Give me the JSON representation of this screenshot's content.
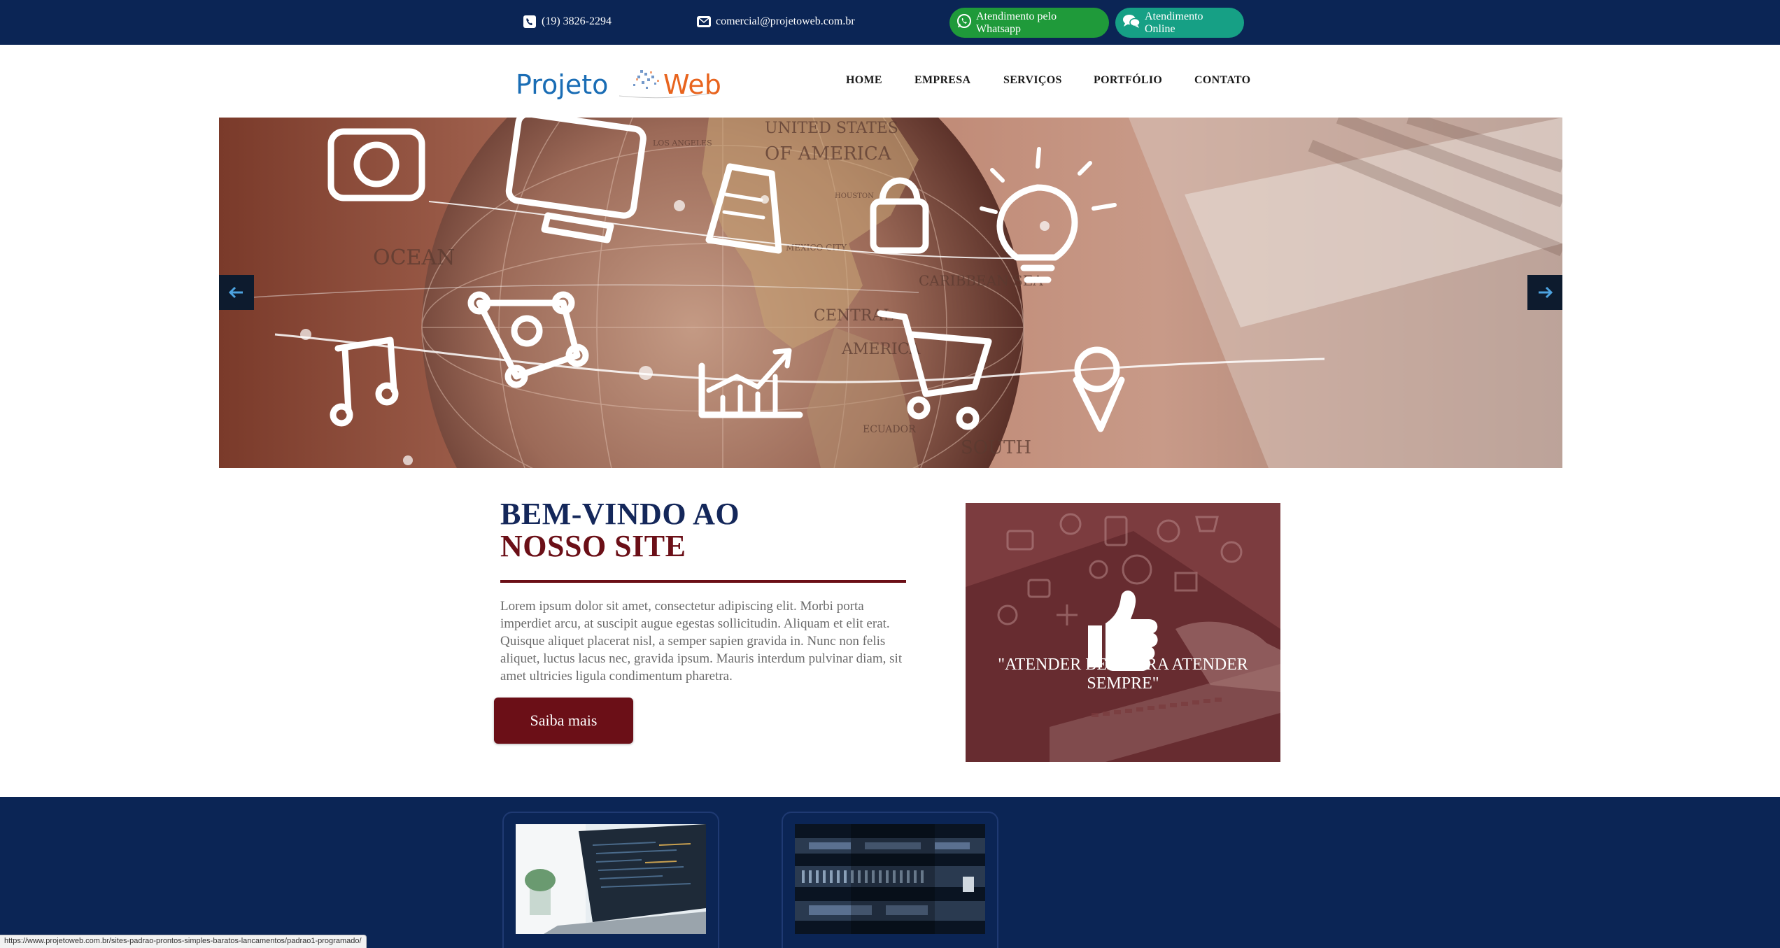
{
  "topbar": {
    "phone": "(19) 3826-2294",
    "email": "comercial@projetoweb.com.br",
    "whatsapp_label": "Atendimento pelo Whatsapp",
    "online_label": "Atendimento Online"
  },
  "logo": {
    "part1": "Projeto",
    "part2": "Web"
  },
  "nav": [
    {
      "label": "HOME"
    },
    {
      "label": "EMPRESA"
    },
    {
      "label": "SERVIÇOS"
    },
    {
      "label": "PORTFÓLIO"
    },
    {
      "label": "CONTATO"
    }
  ],
  "banner": {
    "map_labels": [
      "UNITED STATES",
      "OF AMERICA",
      "CARIBBEAN SEA",
      "CENTRAL",
      "AMERICA",
      "SOUTH",
      "ECUADOR",
      "MEXICO CITY",
      "HOUSTON",
      "LOS ANGELES",
      "OCEAN"
    ]
  },
  "welcome": {
    "title_line1": "BEM-VINDO AO",
    "title_line2": "NOSSO SITE",
    "body": "Lorem ipsum dolor sit amet, consectetur adipiscing elit. Morbi porta imperdiet arcu, at suscipit augue egestas sollicitudin. Aliquam et elit erat. Quisque aliquet placerat nisl, a semper sapien gravida in. Nunc non felis aliquet, luctus lacus nec, gravida ipsum. Mauris interdum pulvinar diam, sit amet ultricies ligula condimentum pharetra.",
    "button_label": "Saiba mais"
  },
  "quote": {
    "text": "\"ATENDER BEM PARA ATENDER SEMPRE\""
  },
  "status_bar": {
    "url": "https://www.projetoweb.com.br/sites-padrao-prontos-simples-baratos-lancamentos/padrao1-programado/"
  },
  "colors": {
    "navy": "#0b2555",
    "maroon": "#6b0f17",
    "whatsapp_green": "#1f9a3a",
    "online_teal": "#16a085",
    "logo_blue": "#1a6db5",
    "logo_orange": "#e8641e"
  },
  "icons": [
    "phone-icon",
    "email-icon",
    "whatsapp-icon",
    "chat-icon",
    "arrow-left-icon",
    "arrow-right-icon",
    "thumbs-up-icon"
  ]
}
